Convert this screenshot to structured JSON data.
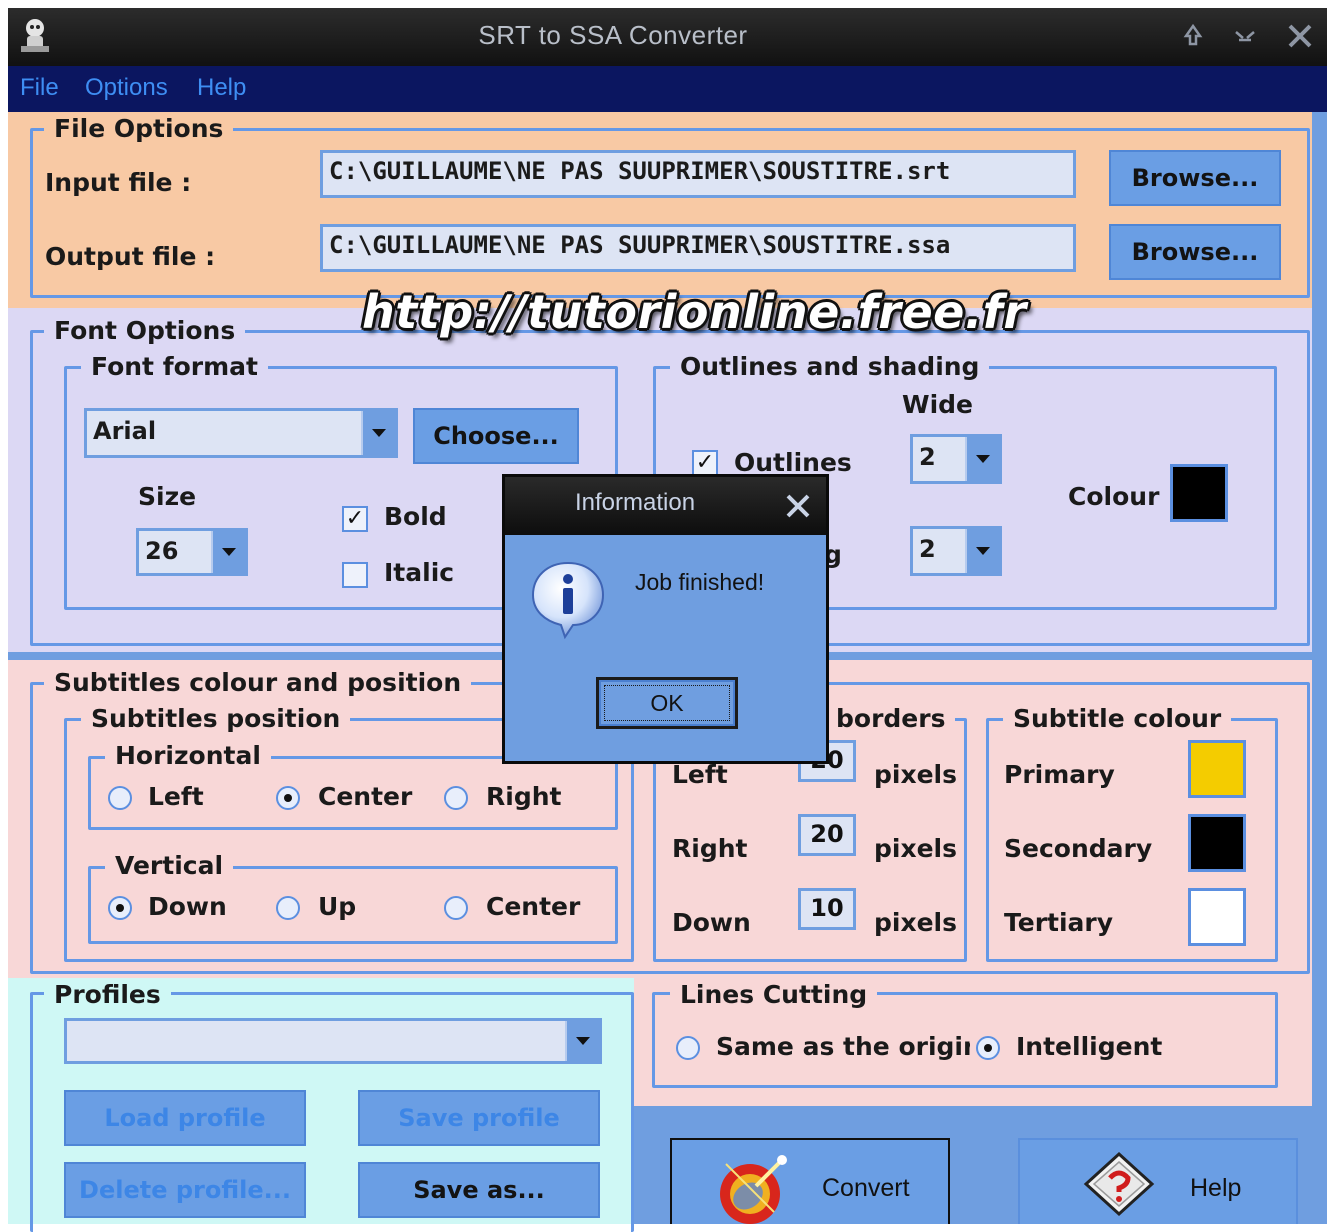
{
  "window": {
    "title": "SRT to SSA Converter"
  },
  "menu": [
    "File",
    "Options",
    "Help"
  ],
  "file_options": {
    "title": "File Options",
    "input_label": "Input file :",
    "input_value": "C:\\GUILLAUME\\NE PAS SUUPRIMER\\SOUSTITRE.srt",
    "output_label": "Output file :",
    "output_value": "C:\\GUILLAUME\\NE PAS SUUPRIMER\\SOUSTITRE.ssa",
    "browse_label": "Browse..."
  },
  "watermark": "http://tutorionline.free.fr",
  "font_options": {
    "title": "Font Options",
    "font_format": {
      "title": "Font format",
      "font": "Arial",
      "choose_label": "Choose...",
      "size_label": "Size",
      "size_value": "26",
      "bold_label": "Bold",
      "bold_checked": true,
      "italic_label": "Italic",
      "italic_checked": false
    },
    "outlines": {
      "title": "Outlines and shading",
      "wide_label": "Wide",
      "outlines_label": "Outlines",
      "outlines_checked": true,
      "shading_label_visible": "g",
      "outline_wide": "2",
      "shading_wide": "2",
      "colour_label": "Colour",
      "colour": "#000000"
    }
  },
  "subtitles": {
    "title": "Subtitles colour and position",
    "position": {
      "title": "Subtitles position",
      "horizontal": {
        "title": "Horizontal",
        "options": [
          "Left",
          "Center",
          "Right"
        ],
        "selected": "Center"
      },
      "vertical": {
        "title": "Vertical",
        "options": [
          "Down",
          "Up",
          "Center"
        ],
        "selected": "Down"
      }
    },
    "borders": {
      "title": "borders",
      "rows": [
        {
          "label": "Left",
          "value": "20",
          "unit": "pixels"
        },
        {
          "label": "Right",
          "value": "20",
          "unit": "pixels"
        },
        {
          "label": "Down",
          "value": "10",
          "unit": "pixels"
        }
      ]
    },
    "colour": {
      "title": "Subtitle colour",
      "rows": [
        {
          "label": "Primary",
          "color": "#f4cc00"
        },
        {
          "label": "Secondary",
          "color": "#000000"
        },
        {
          "label": "Tertiary",
          "color": "#ffffff"
        }
      ]
    }
  },
  "profiles": {
    "title": "Profiles",
    "load_label": "Load profile",
    "save_label": "Save profile",
    "delete_label": "Delete profile...",
    "save_as_label": "Save as..."
  },
  "lines_cutting": {
    "title": "Lines Cutting",
    "options": [
      "Same as the origina",
      "Intelligent"
    ],
    "selected": "Intelligent"
  },
  "actions": {
    "convert_label": "Convert",
    "help_label": "Help"
  },
  "dialog": {
    "title": "Information",
    "message": "Job finished!",
    "ok_label": "OK"
  },
  "colors": {
    "file_panel": "#f8c9a4",
    "font_panel": "#dcd8f4",
    "subtitles_panel": "#f8d7d7",
    "profiles_panel": "#cff8f5",
    "client": "#6f9ee0"
  }
}
